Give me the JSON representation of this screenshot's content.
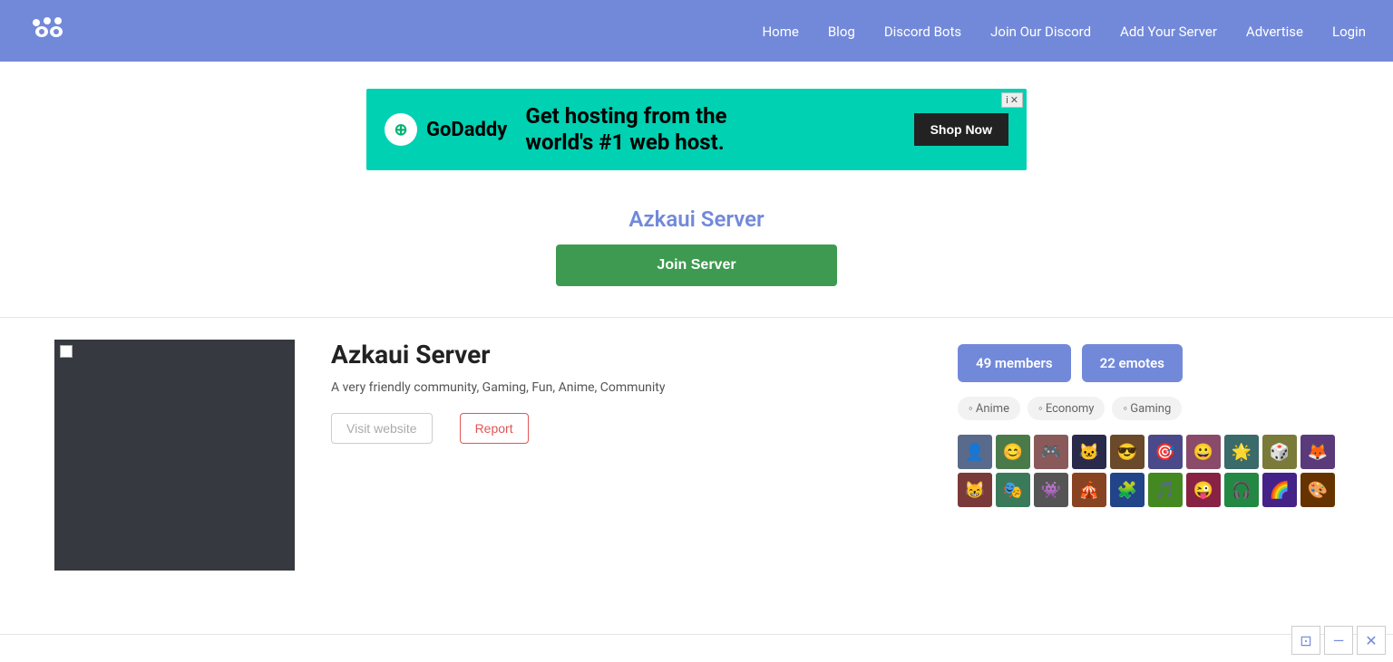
{
  "header": {
    "logo_alt": "Discord Server List",
    "nav_items": [
      {
        "label": "Home",
        "href": "#"
      },
      {
        "label": "Blog",
        "href": "#"
      },
      {
        "label": "Discord Bots",
        "href": "#"
      },
      {
        "label": "Join Our Discord",
        "href": "#"
      },
      {
        "label": "Add Your Server",
        "href": "#"
      },
      {
        "label": "Advertise",
        "href": "#"
      },
      {
        "label": "Login",
        "href": "#"
      }
    ]
  },
  "ad": {
    "brand": "GoDaddy",
    "headline_line1": "Get hosting from the",
    "headline_line2": "world's #1 web host.",
    "cta_label": "Shop Now"
  },
  "server_hero": {
    "title": "Azkaui Server",
    "join_button": "Join Server"
  },
  "server_detail": {
    "name": "Azkaui Server",
    "description": "A very friendly community, Gaming, Fun, Anime, Community",
    "visit_website_label": "Visit website",
    "report_label": "Report",
    "members_badge": "49 members",
    "emotes_badge": "22 emotes",
    "tags": [
      "Anime",
      "Economy",
      "Gaming"
    ],
    "member_count": 20,
    "avatar_colors": [
      "av1",
      "av2",
      "av3",
      "av4",
      "av5",
      "av6",
      "av7",
      "av8",
      "av9",
      "av10",
      "av11",
      "av12",
      "av13",
      "av14",
      "av15",
      "av16",
      "av17",
      "av18",
      "av19",
      "av20"
    ]
  },
  "bottom_widget": {
    "icons": [
      "⊡",
      "—",
      "✕"
    ]
  }
}
